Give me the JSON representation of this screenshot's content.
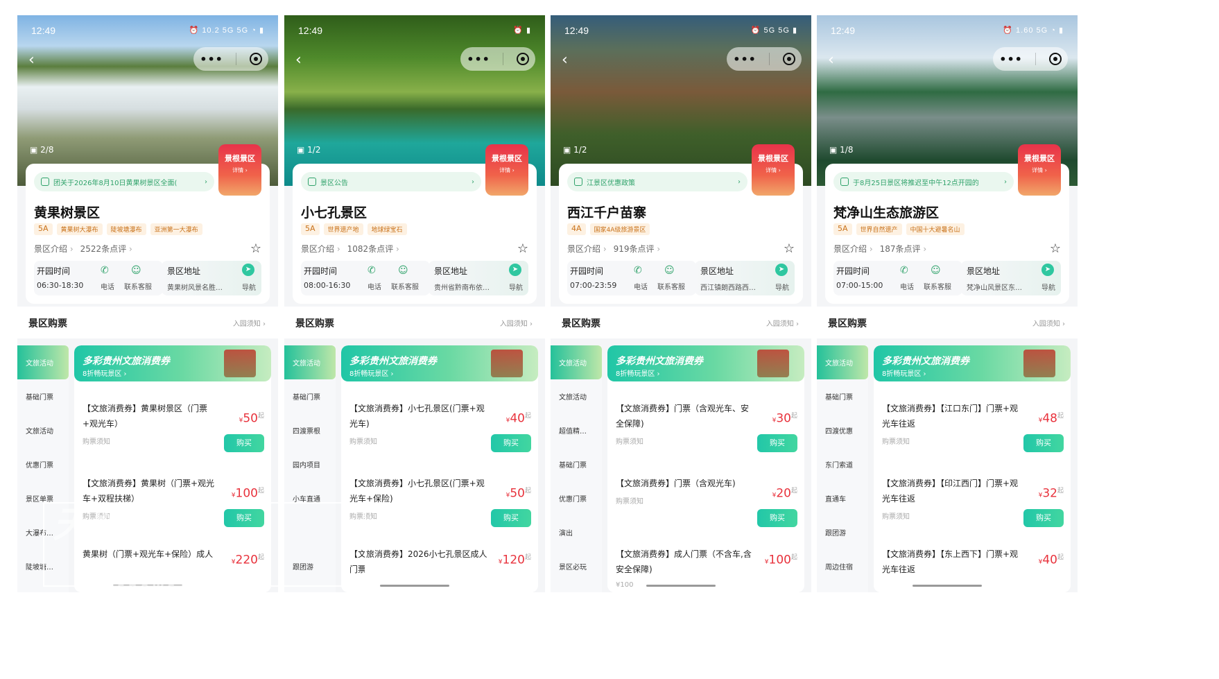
{
  "screens": [
    {
      "time": "12:49",
      "status_icons": "⏰ 10.2 5G 5G ◔ ▮",
      "photo_count": "2/8",
      "badge": "景根景区",
      "badge_sub": "详情 ›",
      "notice": "团关于2026年8月10日黄果树景区全面(",
      "name": "黄果树景区",
      "level": "5A",
      "tags": [
        "黄果树大瀑布",
        "陡坡塘瀑布",
        "亚洲第一大瀑布"
      ],
      "intro": "景区介绍",
      "reviews": "2522条点评",
      "open_label": "开园时间",
      "open_time": "06:30-18:30",
      "phone": "电话",
      "service": "联系客服",
      "addr_label": "景区地址",
      "addr": "黄果树风景名胜…",
      "nav": "导航",
      "ticket_title": "景区购票",
      "entry_notice": "入园须知 ›",
      "sidebar": [
        "文旅活动",
        "基础门票",
        "文旅活动",
        "优惠门票",
        "景区单票",
        "大瀑布…",
        "陡坡塘…"
      ],
      "banner_title": "多彩贵州文旅消费券",
      "banner_sub": "8折畅玩景区 ›",
      "products": [
        {
          "title": "【文旅消费券】黄果树景区（门票+观光车）",
          "price": "50",
          "note": "购票须知",
          "buy": "购买"
        },
        {
          "title": "【文旅消费券】黄果树（门票+观光车+双程扶梯）",
          "price": "100",
          "note": "购票须知",
          "buy": "购买"
        },
        {
          "title": "黄果树（门票+观光车+保险）成人",
          "price": "220",
          "note": "",
          "buy": ""
        }
      ]
    },
    {
      "time": "12:49",
      "status_icons": "⏰ ▮",
      "photo_count": "1/2",
      "badge": "景根景区",
      "badge_sub": "详情 ›",
      "notice": "景区公告",
      "name": "小七孔景区",
      "level": "5A",
      "tags": [
        "世界遗产地",
        "地球绿宝石"
      ],
      "intro": "景区介绍",
      "reviews": "1082条点评",
      "open_label": "开园时间",
      "open_time": "08:00-16:30",
      "phone": "电话",
      "service": "联系客服",
      "addr_label": "景区地址",
      "addr": "贵州省黔南布依…",
      "nav": "导航",
      "ticket_title": "景区购票",
      "entry_notice": "入园须知 ›",
      "sidebar": [
        "文旅活动",
        "基础门票",
        "四渡票根",
        "园内项目",
        "小车直通",
        "",
        "跟团游"
      ],
      "banner_title": "多彩贵州文旅消费券",
      "banner_sub": "8折畅玩景区 ›",
      "products": [
        {
          "title": "【文旅消费券】小七孔景区(门票+观光车)",
          "price": "40",
          "note": "购票须知",
          "buy": "购买"
        },
        {
          "title": "【文旅消费券】小七孔景区(门票+观光车+保险)",
          "price": "50",
          "note": "购票须知",
          "buy": "购买"
        },
        {
          "title": "【文旅消费券】2026小七孔景区成人门票",
          "price": "120",
          "note": "",
          "buy": ""
        }
      ]
    },
    {
      "time": "12:49",
      "status_icons": "⏰ 5G 5G ▮",
      "photo_count": "1/2",
      "badge": "景根景区",
      "badge_sub": "详情 ›",
      "notice": "江景区优惠政策",
      "name": "西江千户苗寨",
      "level": "4A",
      "tags": [
        "国家4A级旅游景区"
      ],
      "intro": "景区介绍",
      "reviews": "919条点评",
      "open_label": "开园时间",
      "open_time": "07:00-23:59",
      "phone": "电话",
      "service": "联系客服",
      "addr_label": "景区地址",
      "addr": "西江镇朗西路西…",
      "nav": "导航",
      "ticket_title": "景区购票",
      "entry_notice": "入园须知 ›",
      "sidebar": [
        "文旅活动",
        "文旅活动",
        "超值精…",
        "基础门票",
        "优惠门票",
        "演出",
        "景区必玩"
      ],
      "banner_title": "多彩贵州文旅消费券",
      "banner_sub": "8折畅玩景区 ›",
      "products": [
        {
          "title": "【文旅消费券】门票（含观光车、安全保障)",
          "price": "30",
          "note": "购票须知",
          "buy": "购买"
        },
        {
          "title": "【文旅消费券】门票（含观光车)",
          "price": "20",
          "note": "购票须知",
          "buy": "购买"
        },
        {
          "title": "【文旅消费券】成人门票（不含车,含安全保障)",
          "price": "100",
          "note": "¥100",
          "buy": ""
        }
      ]
    },
    {
      "time": "12:49",
      "status_icons": "⏰ 1.60 5G ◔ ▮",
      "photo_count": "1/8",
      "badge": "景根景区",
      "badge_sub": "详情 ›",
      "notice": "于8月25日景区将推迟至中午12点开园的",
      "name": "梵净山生态旅游区",
      "level": "5A",
      "tags": [
        "世界自然遗产",
        "中国十大避暑名山"
      ],
      "intro": "景区介绍",
      "reviews": "187条点评",
      "open_label": "开园时间",
      "open_time": "07:00-15:00",
      "phone": "电话",
      "service": "联系客服",
      "addr_label": "景区地址",
      "addr": "梵净山风景区东…",
      "nav": "导航",
      "ticket_title": "景区购票",
      "entry_notice": "入园须知 ›",
      "sidebar": [
        "文旅活动",
        "基础门票",
        "四渡优惠",
        "东门索道",
        "直通车",
        "跟团游",
        "周边住宿"
      ],
      "banner_title": "多彩贵州文旅消费券",
      "banner_sub": "8折畅玩景区 ›",
      "products": [
        {
          "title": "【文旅消费券】【江口东门】门票+观光车往返",
          "price": "48",
          "note": "购票须知",
          "buy": "购买"
        },
        {
          "title": "【文旅消费券】【印江西门】门票+观光车往返",
          "price": "32",
          "note": "购票须知",
          "buy": "购买"
        },
        {
          "title": "【文旅消费券】【东上西下】门票+观光车往返",
          "price": "40",
          "note": "",
          "buy": ""
        }
      ]
    }
  ],
  "watermark": "天眼新闻",
  "watermark_sub": "eyesnews",
  "price_suffix": "起",
  "currency": "¥"
}
